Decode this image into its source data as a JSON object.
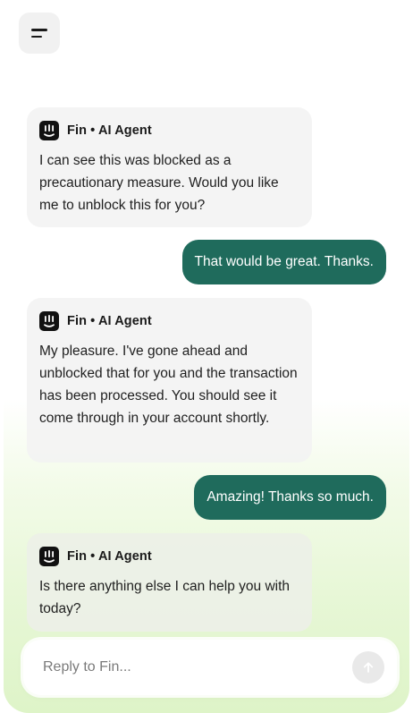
{
  "header": {
    "menu_icon": "menu-icon"
  },
  "messages": [
    {
      "role": "agent",
      "author": "Fin • AI Agent",
      "logo": "fin-logo-icon",
      "text": "I can see this was blocked  as a precautionary measure. Would you like me to unblock this for you?"
    },
    {
      "role": "user",
      "text": "That would be great. Thanks."
    },
    {
      "role": "agent",
      "author": "Fin • AI Agent",
      "logo": "fin-logo-icon",
      "text": "My pleasure. I've gone ahead and unblocked that for you and the transaction has been processed. You should see it come through in your account shortly."
    },
    {
      "role": "user",
      "text": "Amazing! Thanks so much."
    },
    {
      "role": "agent",
      "author": "Fin • AI Agent",
      "logo": "fin-logo-icon",
      "text": "Is there anything else I can help you with today?"
    }
  ],
  "composer": {
    "placeholder": "Reply to Fin...",
    "send_icon": "arrow-up-icon"
  },
  "colors": {
    "user_bubble": "#1f6b5c",
    "agent_bubble": "#f2f2f2",
    "background_accent": "#def4c8"
  }
}
